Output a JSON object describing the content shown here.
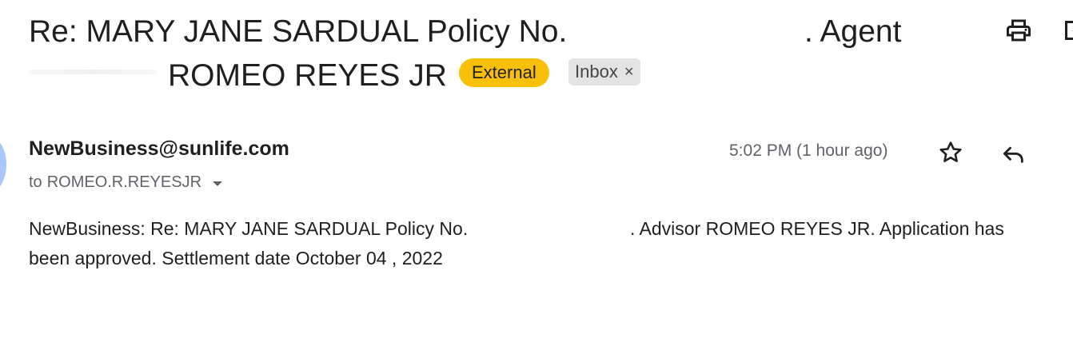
{
  "subject": {
    "line1": "Re: MARY JANE SARDUAL Policy No.",
    "agent": ". Agent",
    "line2": "ROMEO REYES JR"
  },
  "labels": {
    "external": "External",
    "inbox": "Inbox",
    "inbox_remove": "×"
  },
  "toolbar": {
    "print_icon": "print-icon",
    "new_window_icon": "open-in-new-window-icon"
  },
  "message": {
    "sender": "NewBusiness@sunlife.com",
    "to_prefix": "to",
    "recipient": "ROMEO.R.REYESJR",
    "time": "5:02 PM (1 hour ago)",
    "body_line1a": "NewBusiness: Re: MARY JANE SARDUAL Policy No.",
    "body_line1b": ". Advisor ROMEO REYES JR. Application has",
    "body_line2": "been approved.  Settlement date October 04 , 2022"
  },
  "colors": {
    "external_label": "#f9c00b",
    "inbox_label": "#e3e3e3",
    "avatar": "#a8c7fa"
  }
}
